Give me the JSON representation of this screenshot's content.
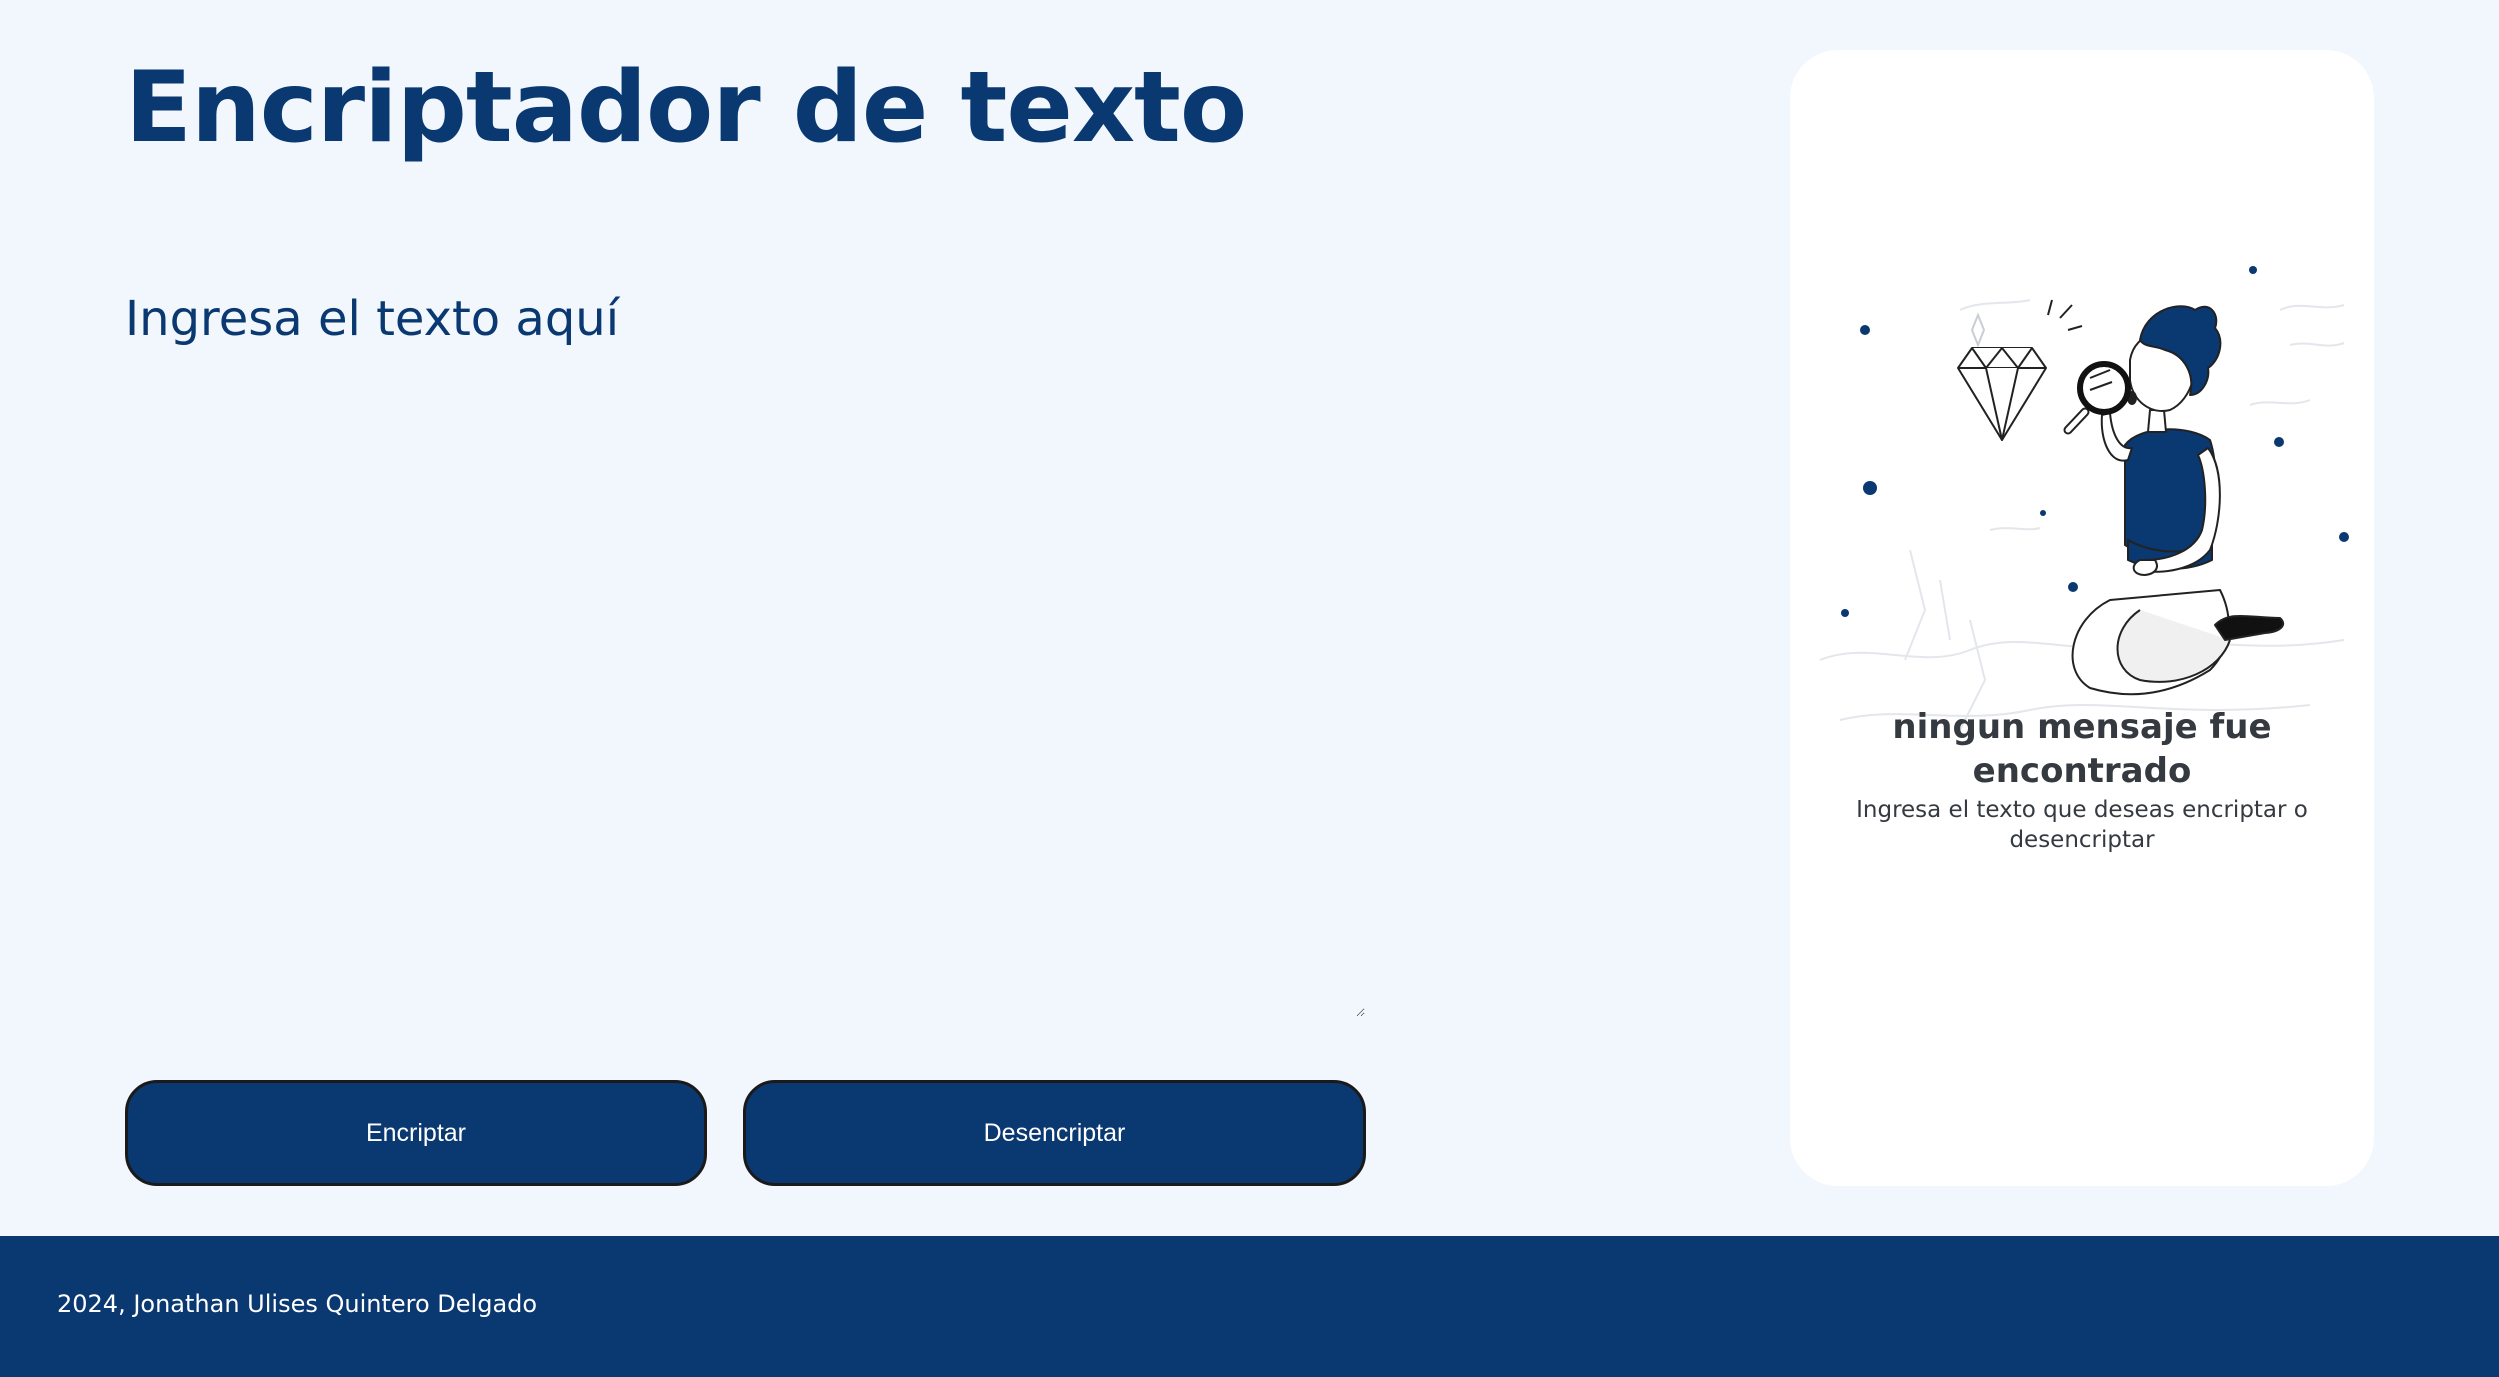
{
  "header": {
    "title": "Encriptador de texto"
  },
  "input": {
    "placeholder": "Ingresa el texto aquí",
    "value": ""
  },
  "actions": {
    "encrypt_label": "Encriptar",
    "decrypt_label": "Desencriptar"
  },
  "result": {
    "illustration_icon": "person-with-magnifying-glass-and-diamond-illustration",
    "empty_title": "ningun mensaje fue encontrado",
    "empty_subtitle": "Ingresa el texto que deseas encriptar o desencriptar"
  },
  "footer": {
    "text": "2024, Jonathan Ulises Quintero Delgado"
  },
  "colors": {
    "primary": "#0a3871",
    "background": "#f2f6fd",
    "panel": "#ffffff",
    "text_dark": "#343a40"
  }
}
